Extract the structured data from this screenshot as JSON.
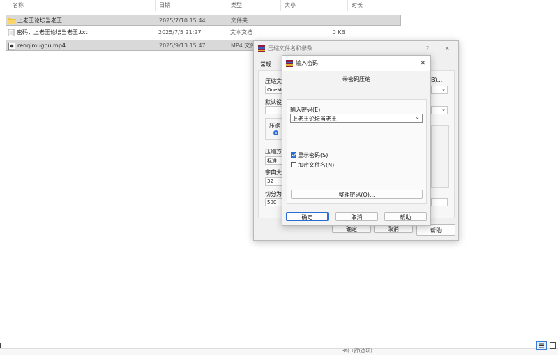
{
  "explorer": {
    "columns": {
      "name": "名称",
      "date": "日期",
      "type": "类型",
      "size": "大小",
      "duration": "时长"
    },
    "rows": [
      {
        "name": "上老王论坛当老王",
        "date": "2025/7/10 15:44",
        "type": "文件夹",
        "size": "",
        "icon": "folder-icon"
      },
      {
        "name": "密码，上老王论坛当老王.txt",
        "date": "2025/7/5 21:27",
        "type": "文本文档",
        "size": "0 KB",
        "icon": "text-file-icon"
      },
      {
        "name": "renqimugpu.mp4",
        "date": "2025/9/13 15:47",
        "type": "MP4 文件",
        "size": "",
        "icon": "video-file-icon"
      }
    ]
  },
  "archive_dialog": {
    "title": "压缩文件名和参数",
    "help_glyph": "?",
    "close_glyph": "✕",
    "tab_general": "常规",
    "archive_name_label": "压缩文",
    "archive_name_value": "OneMo",
    "default_settings_label": "默认设",
    "format_label": "压缩",
    "method_label": "压缩方",
    "method_value": "标准",
    "dict_label": "字典大",
    "dict_value": "32",
    "split_label": "切分为",
    "split_value": "500",
    "browse_suffix": "B)...",
    "ok": "确定",
    "cancel": "取消",
    "help": "帮助"
  },
  "password_dialog": {
    "title": "输入密码",
    "close_glyph": "✕",
    "header": "带密码压缩",
    "enter_label": "输入密码(E)",
    "password_value": "上老王论坛当老王",
    "show_password": "显示密码(S)",
    "show_password_checked": true,
    "encrypt_names": "加密文件名(N)",
    "encrypt_names_checked": false,
    "organize_button": "整理密码(O)...",
    "ok": "确定",
    "cancel": "取消",
    "help": "帮助"
  },
  "bottom_fragment": "3s(  T折(选项)"
}
